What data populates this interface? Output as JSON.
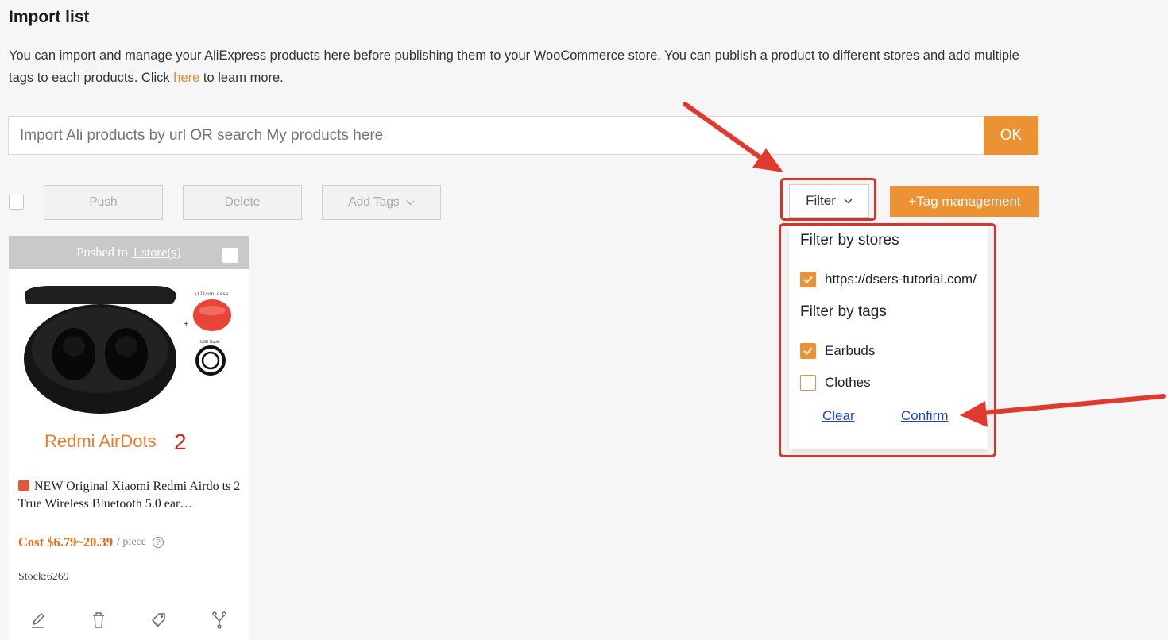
{
  "page": {
    "title": "Import list",
    "intro_text": "You can import and manage your AliExpress products here before publishing them to your WooCommerce store. You can publish a product to different stores and add multiple tags to each products. Click ",
    "intro_link": "here",
    "intro_suffix": " to leam more."
  },
  "search": {
    "placeholder": "Import Ali products by url OR search My products here",
    "button": "OK"
  },
  "toolbar": {
    "push": "Push",
    "delete": "Delete",
    "add_tags": "Add Tags",
    "filter": "Filter",
    "tag_management": "+Tag management"
  },
  "filter_menu": {
    "stores_heading": "Filter by stores",
    "stores": [
      {
        "label": "https://dsers-tutorial.com/",
        "checked": true
      }
    ],
    "tags_heading": "Filter by tags",
    "tags": [
      {
        "label": "Earbuds",
        "checked": true
      },
      {
        "label": "Clothes",
        "checked": false
      }
    ],
    "clear": "Clear",
    "confirm": "Confirm"
  },
  "product": {
    "pushed_prefix": "Pushed to",
    "pushed_link": "1 store(s)",
    "image_brand": "Redmi AirDots",
    "image_model": "2",
    "image_case_label": "silicon case",
    "image_cable_label": "USB Cable",
    "title": "NEW Original Xiaomi Redmi Airdo ts 2 True Wireless Bluetooth 5.0 ear…",
    "cost": "Cost $6.79~20.39",
    "unit": "/ piece",
    "stock": "Stock:6269"
  },
  "colors": {
    "accent": "#ec9134",
    "annotation": "#d9342a",
    "link": "#1a44d8"
  }
}
